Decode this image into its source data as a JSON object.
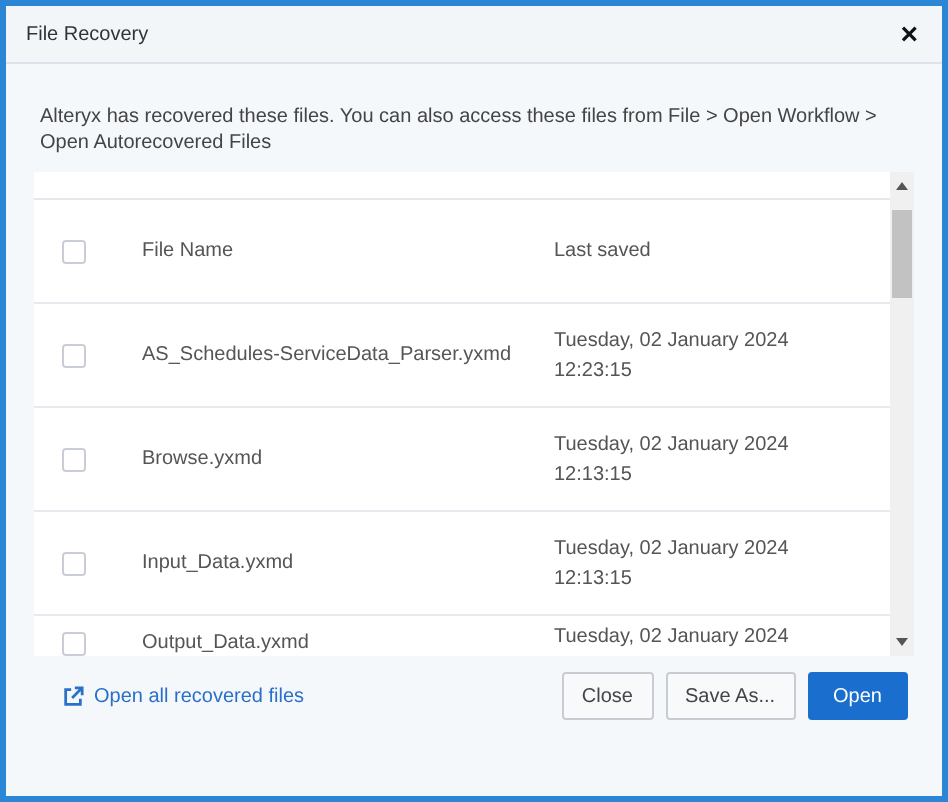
{
  "window": {
    "title": "File Recovery",
    "close": "×"
  },
  "message": "Alteryx has recovered these files. You can also access these files from File > Open Workflow > Open Autorecovered Files",
  "table": {
    "header_checked": false,
    "columns": [
      "File Name",
      "Last saved"
    ],
    "rows": [
      {
        "checked": false,
        "name": "AS_Schedules-ServiceData_Parser.yxmd",
        "date": "Tuesday, 02 January 2024",
        "time": "12:23:15"
      },
      {
        "checked": false,
        "name": "Browse.yxmd",
        "date": "Tuesday, 02 January 2024",
        "time": "12:13:15"
      },
      {
        "checked": false,
        "name": "Input_Data.yxmd",
        "date": "Tuesday, 02 January 2024",
        "time": "12:13:15"
      },
      {
        "checked": false,
        "name": "Output_Data.yxmd",
        "date": "Tuesday, 02 January 2024"
      }
    ]
  },
  "link": "Open all recovered files",
  "buttons": [
    {
      "label": "Close",
      "kind": "secondary"
    },
    {
      "label": "Save As...",
      "kind": "secondary"
    },
    {
      "label": "Open",
      "kind": "primary"
    }
  ]
}
